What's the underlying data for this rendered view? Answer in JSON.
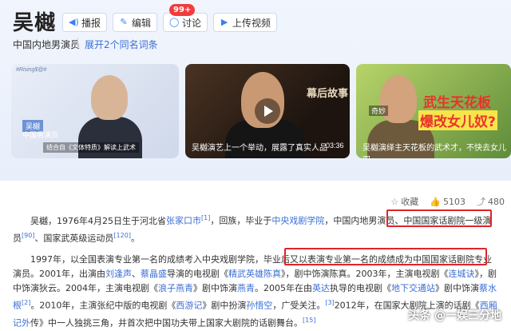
{
  "header": {
    "title": "吴樾",
    "actions": [
      {
        "label": "播报",
        "icon": "speaker-icon"
      },
      {
        "label": "编辑",
        "icon": "edit-icon"
      },
      {
        "label": "讨论",
        "icon": "comment-icon",
        "badge": "99+"
      },
      {
        "label": "上传视频",
        "icon": "upload-video-icon"
      }
    ],
    "subtitle": "中国内地男演员",
    "expand_link": "展开2个同名词条"
  },
  "videos": [
    {
      "logo": "#Rising$@#",
      "name": "吴樾",
      "role": "中国男演员",
      "caption": "结合自《文体特质》解读上武术"
    },
    {
      "caption": "吴樾演艺上一个举动，展露了真实人品",
      "duration": "03:36",
      "poster_text": "幕后故事"
    },
    {
      "caption": "吴樾演绎主天花板的武术才，不快去女儿双",
      "title1": "武生天花板",
      "title2": "爆改女儿奴?",
      "tag": "奇妙"
    }
  ],
  "toolbar": {
    "collect_label": "收藏",
    "likes": "5103",
    "shares": "480"
  },
  "article": {
    "p1": {
      "t1": "吴樾，1976年4月25日生于河北省",
      "link1": "张家口市",
      "ref1": "[1]",
      "t2": "，回族，毕业于",
      "link2": "中央戏剧学院",
      "t3": "，中国内地男演员、中国国家话剧院一级演员",
      "ref2": "[90]",
      "t4": "、国家武英级运动员",
      "ref3": "[120]",
      "t5": "。"
    },
    "p2": {
      "t1": "1997年，以全国表演专业第一名的成绩考入中央戏剧学院，毕业后又以表演专业第一名的成绩成为中国国家话剧院专业演员。2001年，出演由",
      "link1": "刘逢声",
      "t2": "、",
      "link2": "蔡晶盛",
      "t3": "导演的电视剧《",
      "link3": "精武英雄陈真",
      "t4": "》，剧中饰演陈真。2003年，主演电视剧《",
      "link4": "连城诀",
      "t5": "》，剧中饰演狄云。2004年，主演电视剧《",
      "link5": "浪子燕青",
      "t6": "》剧中饰演",
      "link6": "燕青",
      "t7": "。2005年在由",
      "link7": "英达",
      "t8": "执导的电视剧《",
      "link8": "地下交通站",
      "t9": "》剧中饰演",
      "link9": "蔡水根",
      "ref1": "[2]",
      "t10": "。2010年，主演张纪中版的电视剧《",
      "link10": "西游记",
      "t11": "》剧中扮演",
      "link11": "孙悟空",
      "t12": "，广受关注。",
      "ref2": "[3]",
      "t13": "2012年，在国家大剧院上演的话剧《",
      "link12": "西厢记外",
      "t14": "传》中一人独挑三角，并首次把中国功夫带上国家大剧院的话剧舞台。",
      "ref3": "[15]"
    }
  },
  "watermark": "头条 @一娱三分地",
  "colors": {
    "accent": "#3b6fd6",
    "highlight": "#e0242a",
    "badge": "#f23c3c"
  }
}
